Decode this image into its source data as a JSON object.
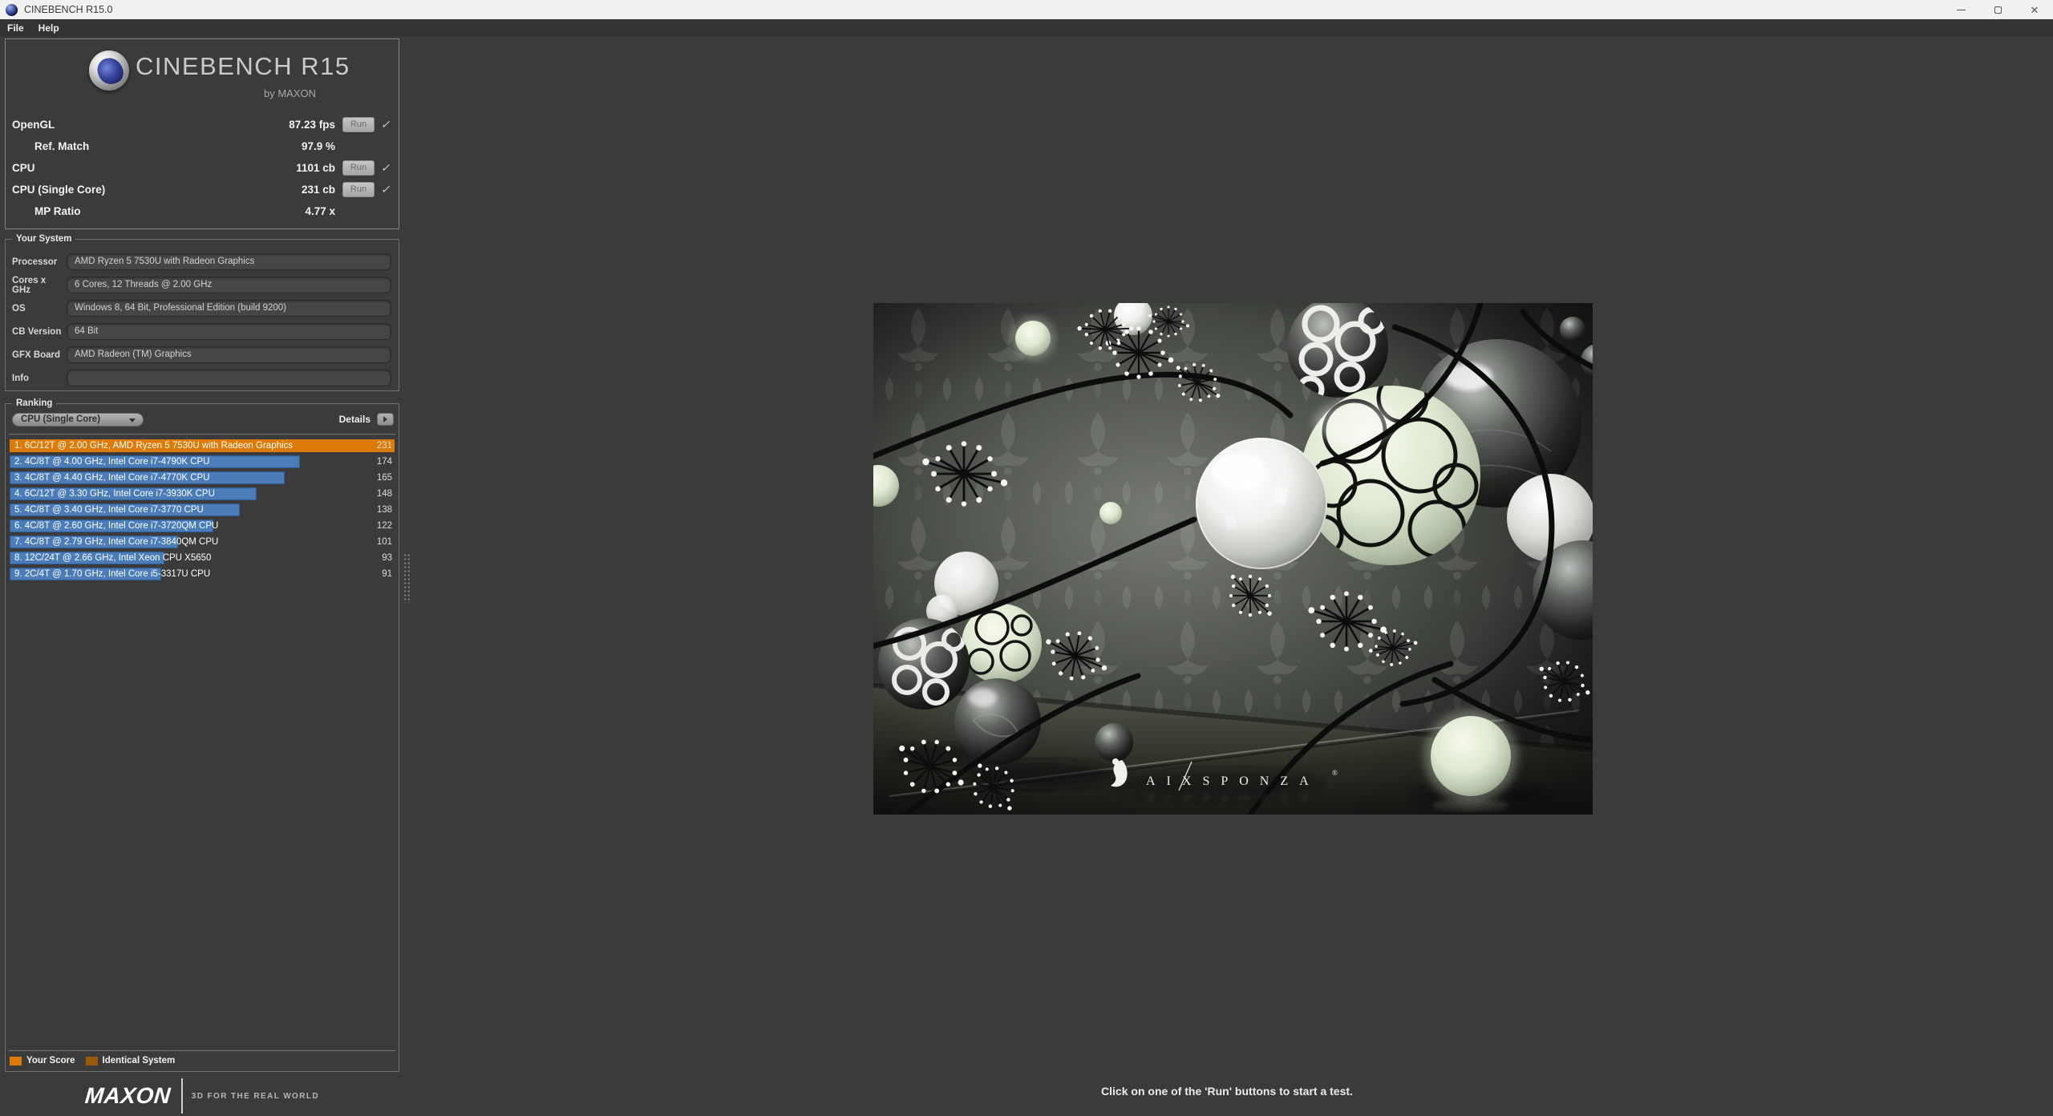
{
  "window": {
    "title": "CINEBENCH R15.0",
    "close_glyph": "✕"
  },
  "menu": {
    "items": [
      {
        "label": "File"
      },
      {
        "label": "Help"
      }
    ]
  },
  "branding": {
    "app_name": "CINEBENCH R15",
    "byline": "by MAXON"
  },
  "results": {
    "run_label": "Run",
    "check_glyph": "✓",
    "rows": [
      {
        "label": "OpenGL",
        "value": "87.23 fps",
        "run": true,
        "check": true,
        "indent": false
      },
      {
        "label": "Ref. Match",
        "value": "97.9 %",
        "run": false,
        "check": false,
        "indent": true
      },
      {
        "label": "CPU",
        "value": "1101 cb",
        "run": true,
        "check": true,
        "indent": false
      },
      {
        "label": "CPU (Single Core)",
        "value": "231 cb",
        "run": true,
        "check": true,
        "indent": false
      },
      {
        "label": "MP Ratio",
        "value": "4.77 x",
        "run": false,
        "check": false,
        "indent": true
      }
    ]
  },
  "your_system": {
    "legend": "Your System",
    "fields": [
      {
        "label": "Processor",
        "value": "AMD Ryzen 5 7530U with Radeon Graphics"
      },
      {
        "label": "Cores x GHz",
        "value": "6 Cores, 12 Threads @ 2.00 GHz"
      },
      {
        "label": "OS",
        "value": "Windows 8, 64 Bit, Professional Edition (build 9200)"
      },
      {
        "label": "CB Version",
        "value": "64 Bit"
      },
      {
        "label": "GFX Board",
        "value": "AMD Radeon (TM) Graphics"
      },
      {
        "label": "Info",
        "value": ""
      }
    ]
  },
  "ranking": {
    "legend": "Ranking",
    "selector_value": "CPU (Single Core)",
    "details_label": "Details",
    "max_score": 231,
    "entries": [
      {
        "rank": 1,
        "label": "1. 6C/12T @ 2.00 GHz, AMD Ryzen 5 7530U with Radeon Graphics",
        "score": 231,
        "highlight": "self"
      },
      {
        "rank": 2,
        "label": "2. 4C/8T @ 4.00 GHz, Intel Core i7-4790K CPU",
        "score": 174,
        "highlight": "other"
      },
      {
        "rank": 3,
        "label": "3. 4C/8T @ 4.40 GHz, Intel Core i7-4770K CPU",
        "score": 165,
        "highlight": "other"
      },
      {
        "rank": 4,
        "label": "4. 6C/12T @ 3.30 GHz,  Intel Core i7-3930K CPU",
        "score": 148,
        "highlight": "other"
      },
      {
        "rank": 5,
        "label": "5. 4C/8T @ 3.40 GHz,  Intel Core i7-3770 CPU",
        "score": 138,
        "highlight": "other"
      },
      {
        "rank": 6,
        "label": "6. 4C/8T @ 2.60 GHz, Intel Core i7-3720QM CPU",
        "score": 122,
        "highlight": "other"
      },
      {
        "rank": 7,
        "label": "7. 4C/8T @ 2.79 GHz,  Intel Core i7-3840QM CPU",
        "score": 101,
        "highlight": "other"
      },
      {
        "rank": 8,
        "label": "8. 12C/24T @ 2.66 GHz, Intel Xeon CPU X5650",
        "score": 93,
        "highlight": "other"
      },
      {
        "rank": 9,
        "label": "9. 2C/4T @ 1.70 GHz,  Intel Core i5-3317U CPU",
        "score": 91,
        "highlight": "other"
      }
    ],
    "legend_items": [
      {
        "label": "Your Score",
        "color": "#DC7B08"
      },
      {
        "label": "Identical System",
        "color": "#9A5A0B"
      }
    ]
  },
  "footer": {
    "brand": "MAXON",
    "tagline": "3D FOR THE REAL WORLD"
  },
  "status": {
    "message": "Click on one of the 'Run' buttons to start a test."
  },
  "render_preview": {
    "watermark": "AIXSPONZA",
    "reg_mark": "®"
  },
  "colors": {
    "accent_orange": "#DC7B08",
    "accent_orange_dark": "#9A5A0B",
    "bar_blue": "#4A7CBA",
    "panel_bg": "#3B3B3B",
    "titlebar_bg": "#F1F1F1",
    "menubar_bg": "#333333"
  }
}
